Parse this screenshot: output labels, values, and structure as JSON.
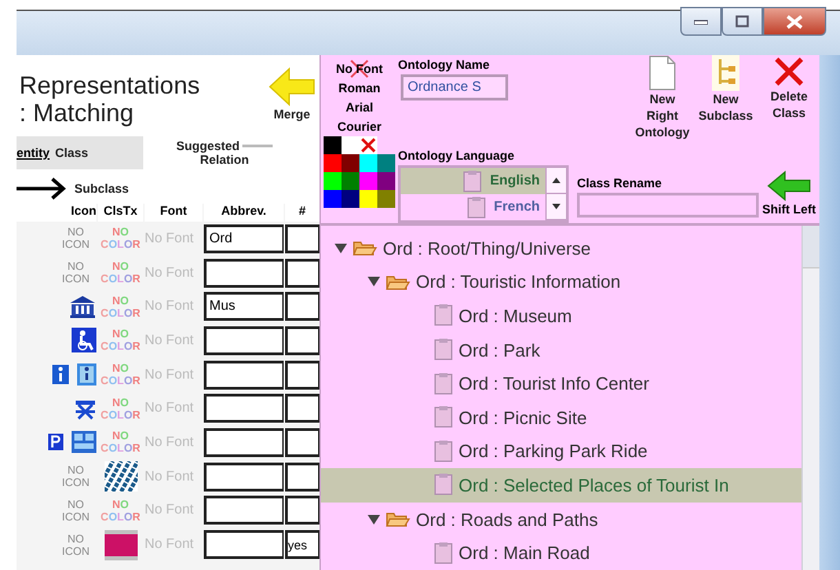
{
  "heading": [
    "Representations",
    ": Matching"
  ],
  "merge": {
    "label": "Merge"
  },
  "legend": {
    "identity": "entity",
    "class": "Class",
    "suggested": "Suggested",
    "relation": "Relation",
    "subclass": "Subclass"
  },
  "columns": [
    "Icon",
    "ClsTx",
    "Font",
    "Abbrev.",
    "#"
  ],
  "rows": [
    {
      "icon": {
        "kind": "none",
        "text": "NO ICON"
      },
      "style": {
        "kind": "none",
        "text": "NO COLOR"
      },
      "font": "No Font",
      "abbrev": "Ord"
    },
    {
      "icon": {
        "kind": "none",
        "text": "NO ICON"
      },
      "style": {
        "kind": "none",
        "text": "NO COLOR"
      },
      "font": "No Font"
    },
    {
      "icon": {
        "kind": "museum"
      },
      "style": {
        "kind": "none",
        "text": "NO COLOR"
      },
      "font": "No Font",
      "abbrev": "Mus"
    },
    {
      "icon": {
        "kind": "accessible"
      },
      "style": {
        "kind": "none",
        "text": "NO COLOR"
      },
      "font": "No Font"
    },
    {
      "icon": {
        "kind": "info"
      },
      "style": {
        "kind": "none",
        "text": "NO COLOR"
      },
      "font": "No Font"
    },
    {
      "icon": {
        "kind": "picnic"
      },
      "style": {
        "kind": "none",
        "text": "NO COLOR"
      },
      "font": "No Font"
    },
    {
      "icon": {
        "kind": "parking"
      },
      "style": {
        "kind": "none",
        "text": "NO COLOR"
      },
      "font": "No Font"
    },
    {
      "icon": {
        "kind": "none",
        "text": "NO ICON"
      },
      "style": {
        "kind": "pattern"
      },
      "font": "No Font"
    },
    {
      "icon": {
        "kind": "none",
        "text": "NO ICON"
      },
      "style": {
        "kind": "none",
        "text": "NO COLOR"
      },
      "font": "No Font"
    },
    {
      "icon": {
        "kind": "none",
        "text": "NO ICON"
      },
      "style": {
        "kind": "swatch",
        "color": "#cc1166"
      },
      "font": "No Font",
      "count": "yes"
    }
  ],
  "fonts": [
    {
      "label": "No Font",
      "crossed": true
    },
    {
      "label": "Roman",
      "crossed": false
    },
    {
      "label": "Arial",
      "crossed": false
    },
    {
      "label": "Courier",
      "crossed": false
    }
  ],
  "palette": [
    [
      {
        "kind": "color",
        "color": "#000000"
      },
      {
        "kind": "color",
        "color": "#ffffff"
      },
      {
        "kind": "none"
      }
    ],
    [
      {
        "kind": "color",
        "color": "#ff0000"
      },
      {
        "kind": "color",
        "color": "#800000"
      },
      {
        "kind": "color",
        "color": "#00ffff"
      },
      {
        "kind": "color",
        "color": "#008080"
      }
    ],
    [
      {
        "kind": "color",
        "color": "#00ff00"
      },
      {
        "kind": "color",
        "color": "#008000"
      },
      {
        "kind": "color",
        "color": "#ff00ff"
      },
      {
        "kind": "color",
        "color": "#800080"
      }
    ],
    [
      {
        "kind": "color",
        "color": "#0000ff"
      },
      {
        "kind": "color",
        "color": "#000080"
      },
      {
        "kind": "color",
        "color": "#ffff00"
      },
      {
        "kind": "color",
        "color": "#808000"
      }
    ]
  ],
  "ontology_name": {
    "label": "Ontology Name",
    "value": "Ordnance S"
  },
  "actions": [
    {
      "kind": "page",
      "label": "New Right Ontology"
    },
    {
      "kind": "tree",
      "label": "New Subclass"
    },
    {
      "kind": "delete",
      "label": "Delete Class"
    }
  ],
  "ontology_language": {
    "label": "Ontology Language",
    "items": [
      {
        "label": "English",
        "selected": true
      },
      {
        "label": "French",
        "selected": false
      }
    ]
  },
  "class_rename": {
    "label": "Class Rename"
  },
  "shift_left": {
    "label": "Shift Left"
  },
  "tree": [
    {
      "label": "Ord : Root/Thing/Universe",
      "kind": "folder",
      "expanded": true,
      "selected": false,
      "children": [
        {
          "label": "Ord : Touristic Information",
          "kind": "folder",
          "expanded": true,
          "selected": false,
          "children": [
            {
              "label": "Ord : Museum",
              "kind": "leaf",
              "selected": false
            },
            {
              "label": "Ord : Park",
              "kind": "leaf",
              "selected": false
            },
            {
              "label": "Ord : Tourist Info Center",
              "kind": "leaf",
              "selected": false
            },
            {
              "label": "Ord : Picnic Site",
              "kind": "leaf",
              "selected": false
            },
            {
              "label": "Ord : Parking Park Ride",
              "kind": "leaf",
              "selected": false
            },
            {
              "label": "Ord : Selected Places of Tourist In",
              "kind": "leaf",
              "selected": true
            }
          ]
        },
        {
          "label": "Ord : Roads and Paths",
          "kind": "folder",
          "expanded": true,
          "selected": false,
          "children": [
            {
              "label": "Ord : Main Road",
              "kind": "leaf",
              "selected": false
            }
          ]
        }
      ]
    }
  ]
}
